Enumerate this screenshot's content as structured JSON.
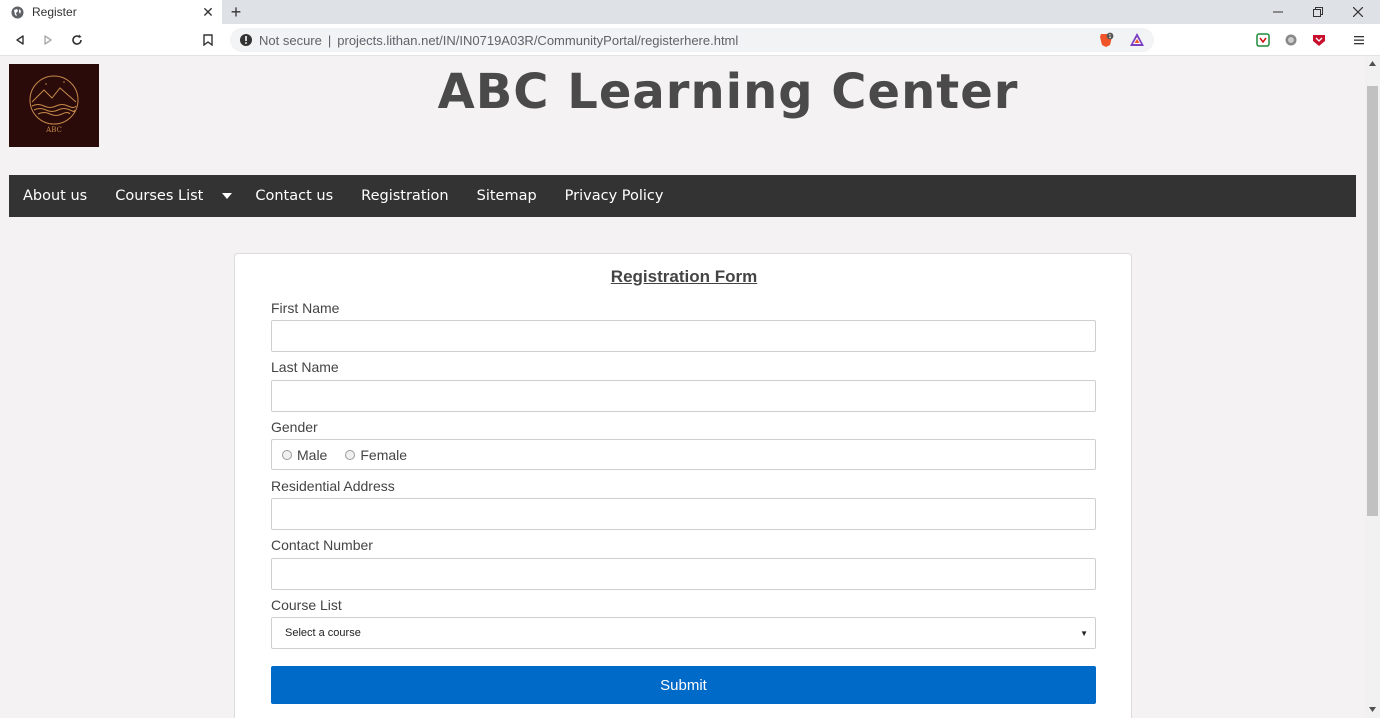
{
  "browser": {
    "tab_title": "Register",
    "security_label": "Not secure",
    "separator": "|",
    "url": "projects.lithan.net/IN/IN0719A03R/CommunityPortal/registerhere.html",
    "icons": [
      "globe-icon",
      "close-icon",
      "plus-icon",
      "back-icon",
      "forward-icon",
      "reload-icon",
      "bookmark-icon",
      "info-icon",
      "brave-shield-icon",
      "brave-rewards-icon",
      "extension-icon",
      "menu-icon",
      "minimize-icon",
      "restore-icon"
    ]
  },
  "header": {
    "logo_text": "ABC",
    "site_title": "ABC Learning Center"
  },
  "nav": {
    "items": [
      "About us",
      "Courses List",
      "Contact us",
      "Registration",
      "Sitemap",
      "Privacy Policy"
    ]
  },
  "form": {
    "title": "Registration Form",
    "first_name_label": "First Name",
    "first_name_value": "",
    "last_name_label": "Last Name",
    "last_name_value": "",
    "gender_label": "Gender",
    "gender_options": [
      "Male",
      "Female"
    ],
    "address_label": "Residential Address",
    "address_value": "",
    "contact_label": "Contact Number",
    "contact_value": "",
    "course_label": "Course List",
    "course_selected": "Select a course",
    "submit_label": "Submit"
  },
  "colors": {
    "navbar": "#333333",
    "page_bg": "#f4f2f2",
    "submit": "#006ac8",
    "title": "#4a4a4a"
  }
}
